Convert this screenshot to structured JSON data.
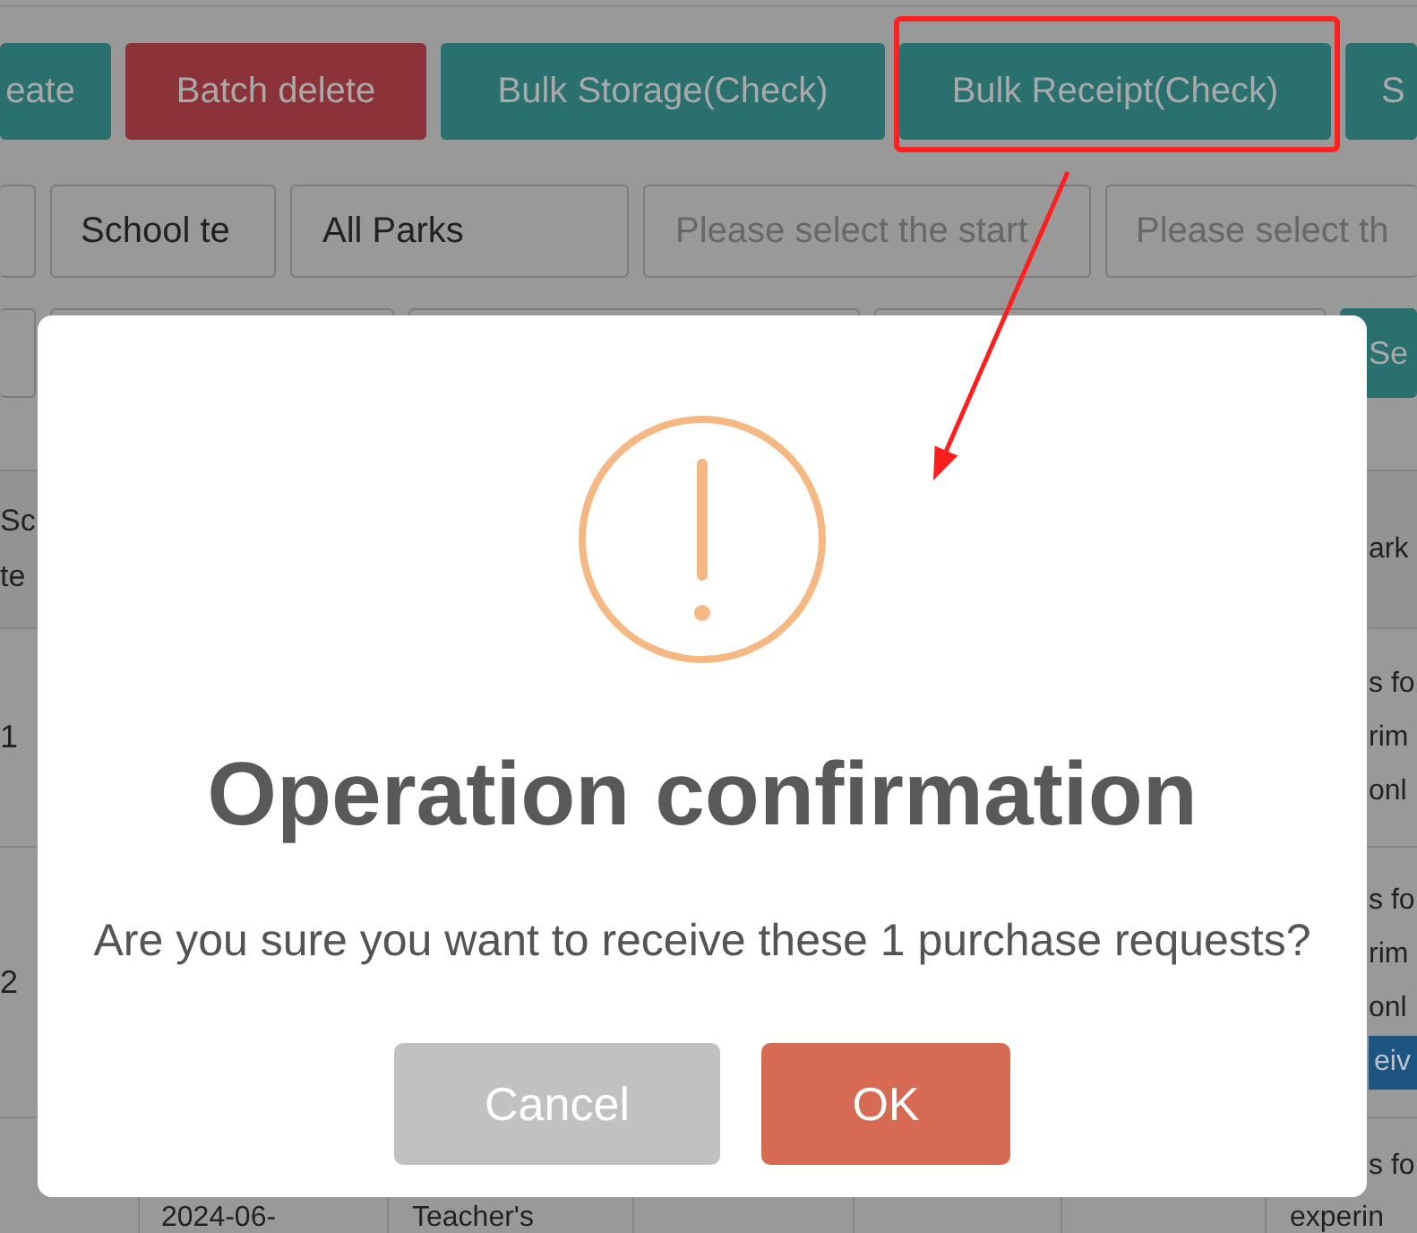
{
  "toolbar": {
    "buttons": [
      {
        "label": "eate",
        "kind": "primary",
        "highlighted": false
      },
      {
        "label": "Batch delete",
        "kind": "danger",
        "highlighted": false
      },
      {
        "label": "Bulk Storage(Check)",
        "kind": "primary",
        "highlighted": false
      },
      {
        "label": "Bulk Receipt(Check)",
        "kind": "primary",
        "highlighted": true
      },
      {
        "label": "S",
        "kind": "primary",
        "highlighted": false
      }
    ]
  },
  "filters": [
    {
      "kind": "input"
    },
    {
      "kind": "input",
      "value": "School te"
    },
    {
      "kind": "input",
      "value": "All Parks"
    },
    {
      "kind": "input",
      "placeholder": "Please select the start"
    },
    {
      "kind": "input",
      "placeholder": "Please select th"
    }
  ],
  "filters_row_2": [
    {
      "kind": "input"
    },
    {
      "kind": "input"
    },
    {
      "kind": "input"
    },
    {
      "kind": "input"
    },
    {
      "kind": "button",
      "label": "Se"
    }
  ],
  "table": {
    "header": {
      "column_1": [
        "Sc",
        "te"
      ],
      "last_column": [
        "ark"
      ]
    },
    "rows": [
      {
        "column_1": "1",
        "last_column": [
          "s fo",
          "rim",
          "onl"
        ]
      },
      {
        "column_1": "2",
        "last_column": [
          "s fo",
          "rim",
          "onl"
        ],
        "badge": "eiv"
      },
      {
        "column_2": "2024-06-",
        "column_3": "Teacher's",
        "last_column": [
          "s fo",
          "experin"
        ]
      }
    ]
  },
  "dialog": {
    "title": "Operation confirmation",
    "message": "Are you sure you want to receive these 1 purchase requests?",
    "buttons": [
      {
        "label": "Cancel",
        "kind": "cancel"
      },
      {
        "label": "OK",
        "kind": "confirm"
      }
    ]
  }
}
